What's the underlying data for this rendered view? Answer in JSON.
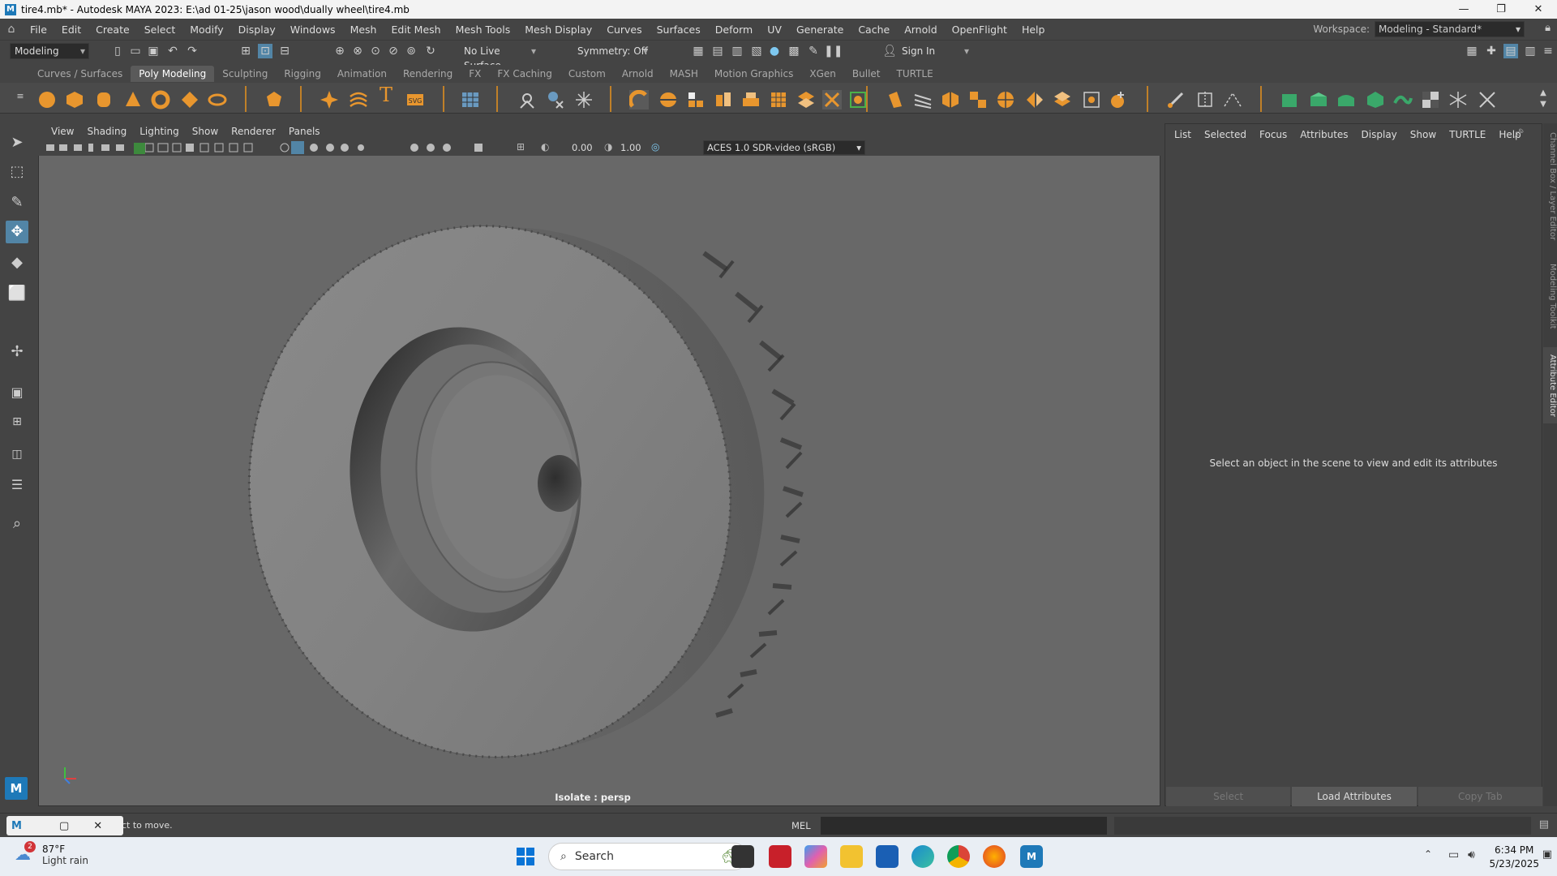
{
  "window": {
    "title": "tire4.mb* - Autodesk MAYA 2023: E:\\ad 01-25\\jason wood\\dually wheel\\tire4.mb",
    "minimize": "—",
    "maximize": "❐",
    "close": "✕"
  },
  "menu": {
    "items": [
      "File",
      "Edit",
      "Create",
      "Select",
      "Modify",
      "Display",
      "Windows",
      "Mesh",
      "Edit Mesh",
      "Mesh Tools",
      "Mesh Display",
      "Curves",
      "Surfaces",
      "Deform",
      "UV",
      "Generate",
      "Cache",
      "Arnold",
      "OpenFlight",
      "Help"
    ],
    "workspace_label": "Workspace:",
    "workspace_value": "Modeling - Standard*"
  },
  "statusline": {
    "menuset": "Modeling",
    "live_surface": "No Live Surface",
    "symmetry": "Symmetry: Off",
    "sign_in": "Sign In"
  },
  "shelf": {
    "tabs": [
      "Curves / Surfaces",
      "Poly Modeling",
      "Sculpting",
      "Rigging",
      "Animation",
      "Rendering",
      "FX",
      "FX Caching",
      "Custom",
      "Arnold",
      "MASH",
      "Motion Graphics",
      "XGen",
      "Bullet",
      "TURTLE"
    ],
    "active_tab": "Poly Modeling"
  },
  "viewport": {
    "menu": [
      "View",
      "Shading",
      "Lighting",
      "Show",
      "Renderer",
      "Panels"
    ],
    "near_value": "0.00",
    "gamma_value": "1.00",
    "color_space": "ACES 1.0 SDR-video (sRGB)",
    "camera_label": "Isolate : persp"
  },
  "attribute_editor": {
    "menu": [
      "List",
      "Selected",
      "Focus",
      "Attributes",
      "Display",
      "Show",
      "TURTLE",
      "Help"
    ],
    "message": "Select an object in the scene to view and edit its attributes",
    "buttons": [
      "Select",
      "Load Attributes",
      "Copy Tab"
    ]
  },
  "side_tabs": [
    "Channel Box / Layer Editor",
    "Modeling Toolkit",
    "Attribute Editor"
  ],
  "commandline": {
    "help_text": "ct to move.",
    "mode": "MEL"
  },
  "taskbar": {
    "weather_badge": "2",
    "temperature": "87°F",
    "condition": "Light rain",
    "search_placeholder": "Search",
    "time": "6:34 PM",
    "date": "5/23/2025"
  },
  "colors": {
    "maya_bg": "#444444",
    "viewport_bg": "#686868",
    "shelf_accent": "#e8962e",
    "selection_blue": "#5285a6"
  }
}
